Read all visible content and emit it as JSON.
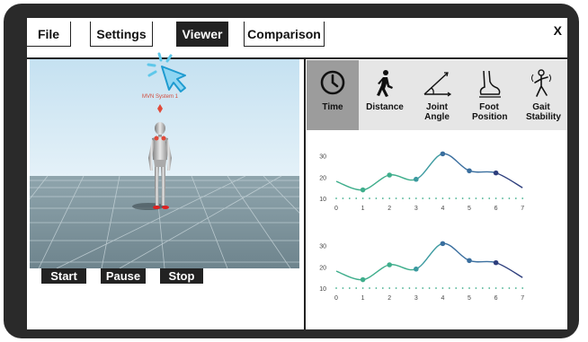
{
  "menu": {
    "tabs": [
      "File",
      "Settings",
      "Viewer",
      "Comparison"
    ],
    "active_tab": "Viewer",
    "close_label": "X"
  },
  "viewer": {
    "avatar_label": "MVN System 1"
  },
  "controls": {
    "start": "Start",
    "pause": "Pause",
    "stop": "Stop"
  },
  "metrics": {
    "time": "Time",
    "distance": "Distance",
    "joint_angle": "Joint Angle",
    "foot_position": "Foot Position",
    "gait_stability": "Gait Stability",
    "active": "Time"
  },
  "colors": {
    "teal": "#3fae8c",
    "blue": "#3a6f9f",
    "navy": "#2e3f7d"
  },
  "chart_data": [
    {
      "type": "line",
      "x": [
        0,
        1,
        2,
        3,
        4,
        5,
        6,
        7
      ],
      "values": [
        18,
        14,
        21,
        19,
        31,
        23,
        22,
        15
      ],
      "yticks": [
        10,
        20,
        30
      ],
      "xticks": [
        "0",
        "1",
        "2",
        "3",
        "4",
        "5",
        "6",
        "7"
      ],
      "ylim": [
        10,
        32
      ]
    },
    {
      "type": "line",
      "x": [
        0,
        1,
        2,
        3,
        4,
        5,
        6,
        7
      ],
      "values": [
        18,
        14,
        21,
        19,
        31,
        23,
        22,
        15
      ],
      "yticks": [
        10,
        20,
        30
      ],
      "xticks": [
        "0",
        "1",
        "2",
        "3",
        "4",
        "5",
        "6",
        "7"
      ],
      "ylim": [
        10,
        32
      ]
    }
  ]
}
